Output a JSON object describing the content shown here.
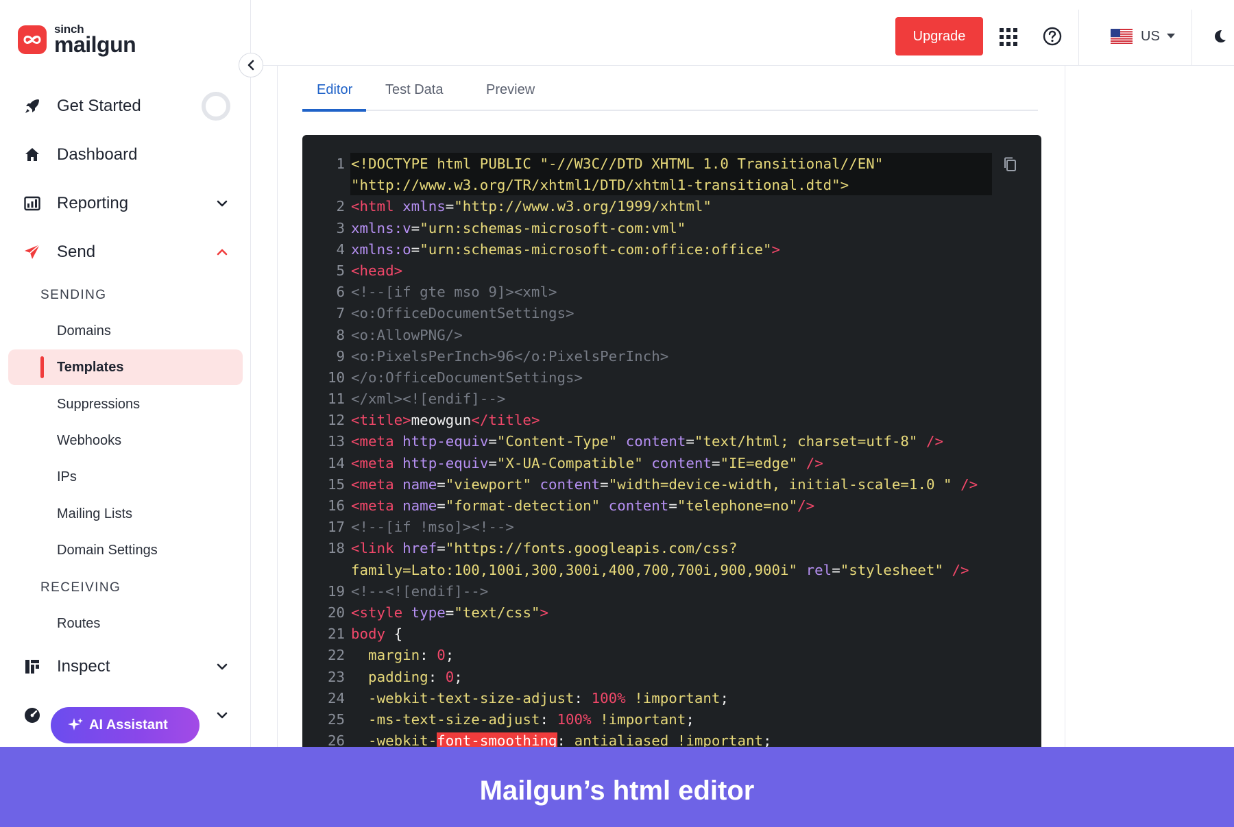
{
  "brand": {
    "sinch": "sinch",
    "mailgun": "mailgun",
    "logo_color": "#f03c3c"
  },
  "sidebar": {
    "get_started": "Get Started",
    "dashboard": "Dashboard",
    "reporting": "Reporting",
    "send": "Send",
    "section_sending": "SENDING",
    "sending_items": [
      "Domains",
      "Templates",
      "Suppressions",
      "Webhooks",
      "IPs",
      "Mailing Lists",
      "Domain Settings"
    ],
    "active_item": "Templates",
    "section_receiving": "RECEIVING",
    "receiving_items": [
      "Routes"
    ],
    "inspect": "Inspect",
    "ai_assistant": "AI Assistant"
  },
  "topbar": {
    "upgrade": "Upgrade",
    "region": "US",
    "icons": [
      "apps-grid-icon",
      "help-icon",
      "us-flag-icon",
      "moon-icon"
    ]
  },
  "tabs": [
    {
      "label": "Editor",
      "active": true
    },
    {
      "label": "Test Data",
      "active": false
    },
    {
      "label": "Preview",
      "active": false
    }
  ],
  "code_lines": [
    {
      "n": "1",
      "t": [
        [
          "y",
          "<!DOCTYPE html PUBLIC \"-//W3C//DTD XHTML 1.0 Transitional//EN\""
        ]
      ]
    },
    {
      "n": "",
      "t": [
        [
          "y",
          "\"http://www.w3.org/TR/xhtml1/DTD/xhtml1-transitional.dtd\">"
        ]
      ]
    },
    {
      "n": "2",
      "t": [
        [
          "r",
          "<html"
        ],
        [
          "w",
          " "
        ],
        [
          "p",
          "xmlns"
        ],
        [
          "w",
          "="
        ],
        [
          "y",
          "\"http://www.w3.org/1999/xhtml\""
        ]
      ]
    },
    {
      "n": "3",
      "t": [
        [
          "p",
          "xmlns:v"
        ],
        [
          "w",
          "="
        ],
        [
          "y",
          "\"urn:schemas-microsoft-com:vml\""
        ]
      ]
    },
    {
      "n": "4",
      "t": [
        [
          "p",
          "xmlns:o"
        ],
        [
          "w",
          "="
        ],
        [
          "y",
          "\"urn:schemas-microsoft-com:office:office\""
        ],
        [
          "r",
          ">"
        ]
      ]
    },
    {
      "n": "5",
      "t": [
        [
          "r",
          "<head>"
        ]
      ]
    },
    {
      "n": "6",
      "t": [
        [
          "c",
          "<!--[if gte mso 9]><xml>"
        ]
      ]
    },
    {
      "n": "7",
      "t": [
        [
          "c",
          "<o:OfficeDocumentSettings>"
        ]
      ]
    },
    {
      "n": "8",
      "t": [
        [
          "c",
          "<o:AllowPNG/>"
        ]
      ]
    },
    {
      "n": "9",
      "t": [
        [
          "c",
          "<o:PixelsPerInch>96</o:PixelsPerInch>"
        ]
      ]
    },
    {
      "n": "10",
      "t": [
        [
          "c",
          "</o:OfficeDocumentSettings>"
        ]
      ]
    },
    {
      "n": "11",
      "t": [
        [
          "c",
          "</xml><![endif]-->"
        ]
      ]
    },
    {
      "n": "12",
      "t": [
        [
          "r",
          "<title>"
        ],
        [
          "w",
          "meowgun"
        ],
        [
          "r",
          "</title>"
        ]
      ]
    },
    {
      "n": "13",
      "t": [
        [
          "r",
          "<meta"
        ],
        [
          "w",
          " "
        ],
        [
          "p",
          "http-equiv"
        ],
        [
          "w",
          "="
        ],
        [
          "y",
          "\"Content-Type\""
        ],
        [
          "w",
          " "
        ],
        [
          "p",
          "content"
        ],
        [
          "w",
          "="
        ],
        [
          "y",
          "\"text/html; charset=utf-8\""
        ],
        [
          "w",
          " "
        ],
        [
          "r",
          "/>"
        ]
      ]
    },
    {
      "n": "14",
      "t": [
        [
          "r",
          "<meta"
        ],
        [
          "w",
          " "
        ],
        [
          "p",
          "http-equiv"
        ],
        [
          "w",
          "="
        ],
        [
          "y",
          "\"X-UA-Compatible\""
        ],
        [
          "w",
          " "
        ],
        [
          "p",
          "content"
        ],
        [
          "w",
          "="
        ],
        [
          "y",
          "\"IE=edge\""
        ],
        [
          "w",
          " "
        ],
        [
          "r",
          "/>"
        ]
      ]
    },
    {
      "n": "15",
      "t": [
        [
          "r",
          "<meta"
        ],
        [
          "w",
          " "
        ],
        [
          "p",
          "name"
        ],
        [
          "w",
          "="
        ],
        [
          "y",
          "\"viewport\""
        ],
        [
          "w",
          " "
        ],
        [
          "p",
          "content"
        ],
        [
          "w",
          "="
        ],
        [
          "y",
          "\"width=device-width, initial-scale=1.0 \""
        ],
        [
          "w",
          " "
        ],
        [
          "r",
          "/>"
        ]
      ]
    },
    {
      "n": "16",
      "t": [
        [
          "r",
          "<meta"
        ],
        [
          "w",
          " "
        ],
        [
          "p",
          "name"
        ],
        [
          "w",
          "="
        ],
        [
          "y",
          "\"format-detection\""
        ],
        [
          "w",
          " "
        ],
        [
          "p",
          "content"
        ],
        [
          "w",
          "="
        ],
        [
          "y",
          "\"telephone=no\""
        ],
        [
          "r",
          "/>"
        ]
      ]
    },
    {
      "n": "17",
      "t": [
        [
          "c",
          "<!--[if !mso]><!-->"
        ]
      ]
    },
    {
      "n": "18",
      "t": [
        [
          "r",
          "<link"
        ],
        [
          "w",
          " "
        ],
        [
          "p",
          "href"
        ],
        [
          "w",
          "="
        ],
        [
          "y",
          "\"https://fonts.googleapis.com/css?"
        ]
      ]
    },
    {
      "n": "",
      "t": [
        [
          "y",
          "family=Lato:100,100i,300,300i,400,700,700i,900,900i\""
        ],
        [
          "w",
          " "
        ],
        [
          "p",
          "rel"
        ],
        [
          "w",
          "="
        ],
        [
          "y",
          "\"stylesheet\""
        ],
        [
          "w",
          " "
        ],
        [
          "r",
          "/>"
        ]
      ]
    },
    {
      "n": "19",
      "t": [
        [
          "c",
          "<!--<![endif]-->"
        ]
      ]
    },
    {
      "n": "20",
      "t": [
        [
          "r",
          "<style"
        ],
        [
          "w",
          " "
        ],
        [
          "p",
          "type"
        ],
        [
          "w",
          "="
        ],
        [
          "y",
          "\"text/css\""
        ],
        [
          "r",
          ">"
        ]
      ]
    },
    {
      "n": "21",
      "t": [
        [
          "r",
          "body"
        ],
        [
          "w",
          " {"
        ]
      ]
    },
    {
      "n": "22",
      "t": [
        [
          "w",
          "  "
        ],
        [
          "y",
          "margin"
        ],
        [
          "w",
          ": "
        ],
        [
          "r",
          "0"
        ],
        [
          "w",
          ";"
        ]
      ]
    },
    {
      "n": "23",
      "t": [
        [
          "w",
          "  "
        ],
        [
          "y",
          "padding"
        ],
        [
          "w",
          ": "
        ],
        [
          "r",
          "0"
        ],
        [
          "w",
          ";"
        ]
      ]
    },
    {
      "n": "24",
      "t": [
        [
          "w",
          "  "
        ],
        [
          "y",
          "-webkit-text-size-adjust"
        ],
        [
          "w",
          ": "
        ],
        [
          "r",
          "100%"
        ],
        [
          "w",
          " "
        ],
        [
          "y",
          "!important"
        ],
        [
          "w",
          ";"
        ]
      ]
    },
    {
      "n": "25",
      "t": [
        [
          "w",
          "  "
        ],
        [
          "y",
          "-ms-text-size-adjust"
        ],
        [
          "w",
          ": "
        ],
        [
          "r",
          "100%"
        ],
        [
          "w",
          " "
        ],
        [
          "y",
          "!important"
        ],
        [
          "w",
          ";"
        ]
      ]
    },
    {
      "n": "26",
      "t": [
        [
          "w",
          "  "
        ],
        [
          "y",
          "-webkit-"
        ],
        [
          "m",
          "font-smoothing"
        ],
        [
          "w",
          ": "
        ],
        [
          "y",
          "antialiased !important"
        ],
        [
          "w",
          ";"
        ]
      ]
    }
  ],
  "banner": {
    "caption": "Mailgun’s html editor",
    "color": "#6e63e6"
  },
  "colors": {
    "accent_red": "#f03c3c",
    "tab_blue": "#1f62c8",
    "code_bg": "#1e2124"
  }
}
